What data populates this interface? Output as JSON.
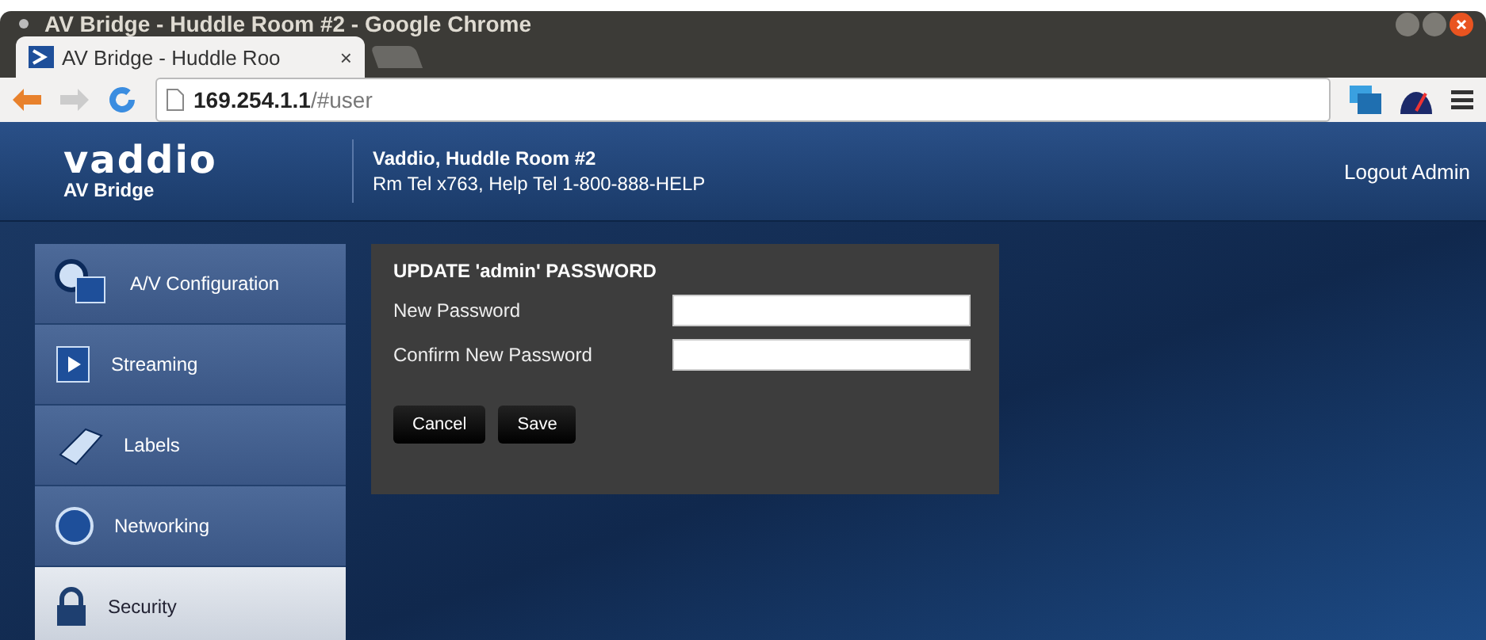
{
  "window": {
    "title": "AV Bridge - Huddle Room #2 - Google Chrome"
  },
  "tabs": [
    {
      "label": "AV Bridge - Huddle Roo",
      "close": "×",
      "selected": true
    }
  ],
  "address_bar": {
    "host": "169.254.1.1",
    "path": "/#user"
  },
  "header": {
    "logo": "vaddio",
    "product": "AV Bridge",
    "room": "Vaddio, Huddle Room #2",
    "contact": "Rm Tel x763, Help Tel 1-800-888-HELP",
    "logout": "Logout Admin"
  },
  "sidebar": {
    "items": [
      {
        "label": "A/V Configuration",
        "selected": false
      },
      {
        "label": "Streaming",
        "selected": false
      },
      {
        "label": "Labels",
        "selected": false
      },
      {
        "label": "Networking",
        "selected": false
      },
      {
        "label": "Security",
        "selected": true
      }
    ]
  },
  "password_form": {
    "title": "UPDATE 'admin' PASSWORD",
    "fields": [
      {
        "label": "New Password"
      },
      {
        "label": "Confirm New Password"
      }
    ],
    "buttons": [
      "Cancel",
      "Save"
    ]
  }
}
